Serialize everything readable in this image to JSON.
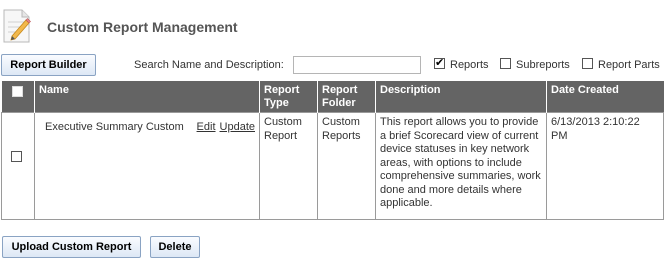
{
  "header": {
    "title": "Custom Report Management",
    "icon": "edit-document-icon"
  },
  "toolbar": {
    "report_builder_label": "Report Builder",
    "search_label": "Search Name and Description:",
    "search_value": "",
    "filters": [
      {
        "label": "Reports",
        "checked": true
      },
      {
        "label": "Subreports",
        "checked": false
      },
      {
        "label": "Report Parts",
        "checked": false
      }
    ]
  },
  "table": {
    "columns": [
      "Name",
      "Report Type",
      "Report Folder",
      "Description",
      "Date Created"
    ],
    "rows": [
      {
        "checked": false,
        "name": "Executive Summary Custom",
        "edit_label": "Edit",
        "update_label": "Update",
        "type": "Custom Report",
        "folder": "Custom Reports",
        "description": "This report allows you to provide a brief Scorecard view of current device statuses in key network areas, with options to include comprehensive summaries, work done and more details where applicable.",
        "date_created": "6/13/2013 2:10:22 PM"
      }
    ]
  },
  "footer": {
    "upload_label": "Upload Custom Report",
    "delete_label": "Delete"
  },
  "colors": {
    "header_bg": "#646464",
    "button_border": "#8aa3c3"
  }
}
